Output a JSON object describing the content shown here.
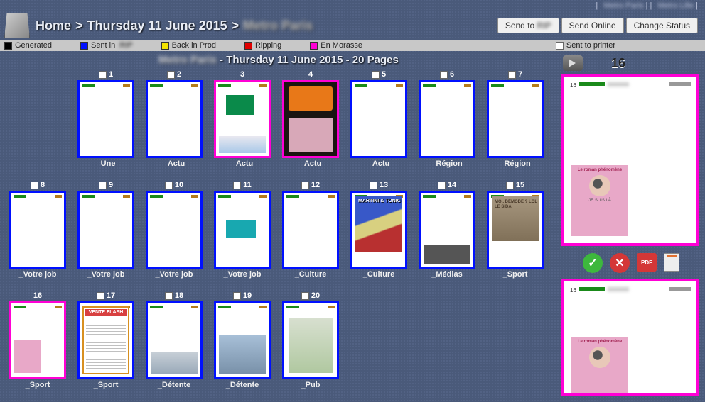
{
  "top_links": [
    "Metro Paris",
    "Metro Lille"
  ],
  "breadcrumb": {
    "home": "Home",
    "sep": ">",
    "date": "Thursday 11 June 2015",
    "pub": "Metro Paris"
  },
  "buttons": {
    "send_to": "Send to",
    "send_to_target": "RIP",
    "send_online": "Send Online",
    "change_status": "Change Status"
  },
  "legend": {
    "generated": {
      "label": "Generated",
      "color": "#000000"
    },
    "sent_in": {
      "label": "Sent in",
      "color": "#0010ff"
    },
    "back_prod": {
      "label": "Back in Prod",
      "color": "#f4e400"
    },
    "ripping": {
      "label": "Ripping",
      "color": "#e00000"
    },
    "morasse": {
      "label": "En Morasse",
      "color": "#ff00d5"
    },
    "sent_printer": {
      "label": "Sent to printer"
    }
  },
  "title": {
    "pub": "Metro Paris",
    "sep": " - ",
    "date": "Thursday 11 June 2015",
    "pages": " - 20 Pages"
  },
  "pages": [
    {
      "n": "1",
      "label": "_Une",
      "status": "sent",
      "checkbox": true
    },
    {
      "n": "2",
      "label": "_Actu",
      "status": "sent",
      "checkbox": true
    },
    {
      "n": "3",
      "label": "_Actu",
      "status": "morasse",
      "checkbox": false
    },
    {
      "n": "4",
      "label": "_Actu",
      "status": "morasse",
      "checkbox": false
    },
    {
      "n": "5",
      "label": "_Actu",
      "status": "sent",
      "checkbox": true
    },
    {
      "n": "6",
      "label": "_Région",
      "status": "sent",
      "checkbox": true
    },
    {
      "n": "7",
      "label": "_Région",
      "status": "sent",
      "checkbox": true
    },
    {
      "n": "8",
      "label": "_Votre job",
      "status": "sent",
      "checkbox": true
    },
    {
      "n": "9",
      "label": "_Votre job",
      "status": "sent",
      "checkbox": true
    },
    {
      "n": "10",
      "label": "_Votre job",
      "status": "sent",
      "checkbox": true
    },
    {
      "n": "11",
      "label": "_Votre job",
      "status": "sent",
      "checkbox": true
    },
    {
      "n": "12",
      "label": "_Culture",
      "status": "sent",
      "checkbox": true
    },
    {
      "n": "13",
      "label": "_Culture",
      "status": "sent",
      "checkbox": true
    },
    {
      "n": "14",
      "label": "_Médias",
      "status": "sent",
      "checkbox": true
    },
    {
      "n": "15",
      "label": "_Sport",
      "status": "sent",
      "checkbox": true
    },
    {
      "n": "16",
      "label": "_Sport",
      "status": "morasse",
      "checkbox": false
    },
    {
      "n": "17",
      "label": "_Sport",
      "status": "sent",
      "checkbox": true
    },
    {
      "n": "18",
      "label": "_Détente",
      "status": "sent",
      "checkbox": true
    },
    {
      "n": "19",
      "label": "_Détente",
      "status": "sent",
      "checkbox": true
    },
    {
      "n": "20",
      "label": "_Pub",
      "status": "sent",
      "checkbox": true
    }
  ],
  "side": {
    "current_page": "16",
    "ad_heading": "Le roman phénomène",
    "ad_sub": "JE SUIS LÀ",
    "pdf": "PDF"
  },
  "c13": "MARTINI & TONIC",
  "c15": "MOI, DÉMODÉ ? LOL LE SIDA",
  "c17": "VENTE FLASH"
}
